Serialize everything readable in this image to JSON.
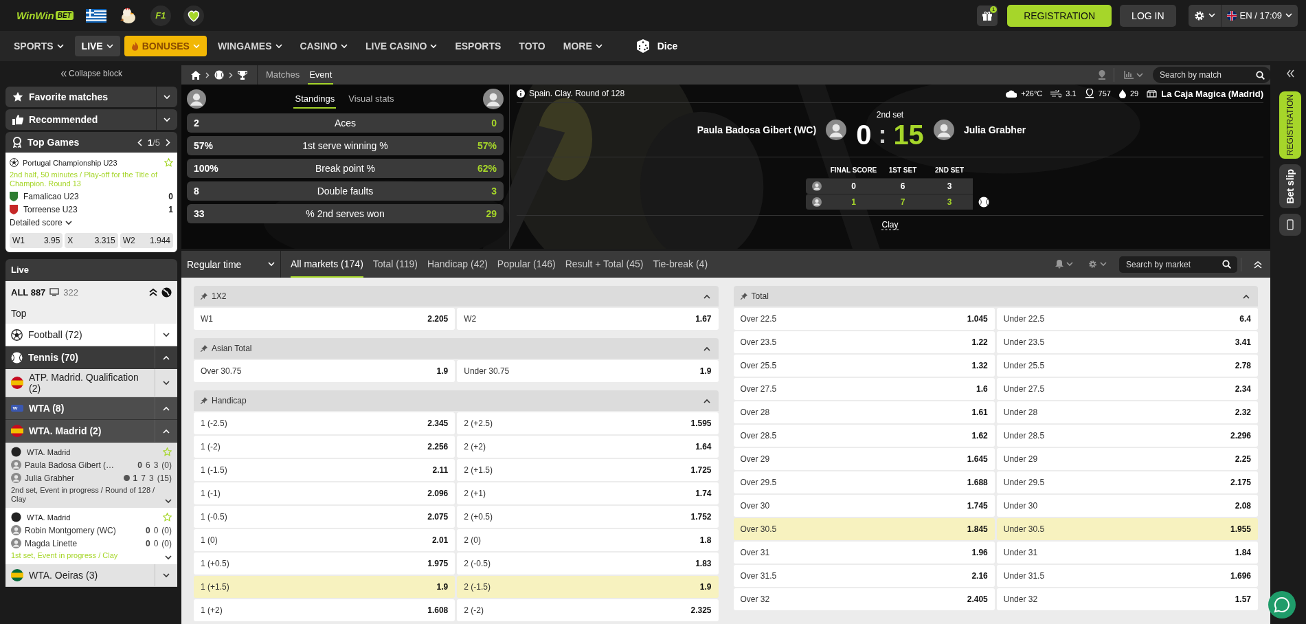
{
  "header": {
    "logo": "WinWin",
    "logo_badge": "BET",
    "f1_badge": "F1",
    "gift_count": "1",
    "registration": "REGISTRATION",
    "login": "LOG IN",
    "locale": "EN / 17:09"
  },
  "nav": [
    {
      "label": "SPORTS",
      "kind": "menu"
    },
    {
      "label": "LIVE",
      "kind": "active"
    },
    {
      "label": "BONUSES",
      "kind": "promo"
    },
    {
      "label": "WINGAMES",
      "kind": "menu"
    },
    {
      "label": "CASINO",
      "kind": "menu"
    },
    {
      "label": "LIVE CASINO",
      "kind": "menu"
    },
    {
      "label": "ESPORTS",
      "kind": "link"
    },
    {
      "label": "TOTO",
      "kind": "link"
    },
    {
      "label": "MORE",
      "kind": "menu"
    },
    {
      "label": "Dice",
      "kind": "dice"
    }
  ],
  "sidebar": {
    "collapse": "Collapse block",
    "panels": [
      {
        "label": "Favorite matches",
        "kind": "favorite"
      },
      {
        "label": "Recommended",
        "kind": "recommended"
      }
    ],
    "top_games": {
      "title": "Top Games",
      "page": "1",
      "pages": "/5",
      "game": {
        "league": "Portugal Championship U23",
        "status": "2nd half, 50 minutes / Play-off for the Title of Champion. Round 13",
        "teams": [
          {
            "name": "Famalicao U23",
            "score": "0",
            "color": "#2e7d32"
          },
          {
            "name": "Torreense U23",
            "score": "1",
            "color": "#c62828"
          }
        ],
        "details": "Detailed score",
        "odds": [
          {
            "label": "W1",
            "value": "3.95"
          },
          {
            "label": "X",
            "value": "3.315"
          },
          {
            "label": "W2",
            "value": "1.944"
          }
        ]
      }
    },
    "live": {
      "title": "Live",
      "all": "ALL 887",
      "tv_count": "322",
      "top": "Top",
      "items": [
        {
          "kind": "sport",
          "label": "Football (72)",
          "expanded": false
        },
        {
          "kind": "sport",
          "label": "Tennis (70)",
          "expanded": true
        },
        {
          "kind": "league",
          "label": "ATP. Madrid. Qualification (2)",
          "color": "#c60b1e",
          "expanded": false
        },
        {
          "kind": "tour",
          "label": "WTA (8)",
          "expanded": true
        },
        {
          "kind": "league",
          "label": "WTA. Madrid (2)",
          "color": "#c60b1e",
          "expanded": true
        },
        {
          "kind": "match",
          "league": "WTA. Madrid",
          "selected": true,
          "status": "2nd set, Event in progress / Round of 128 / Clay",
          "players": [
            {
              "name": "Paula Badosa Gibert (…",
              "serving": false,
              "scores": [
                "0",
                "6",
                "3"
              ],
              "points": "(0)"
            },
            {
              "name": "Julia Grabher",
              "serving": true,
              "scores": [
                "1",
                "7",
                "3"
              ],
              "points": "(15)"
            }
          ]
        },
        {
          "kind": "match",
          "league": "WTA. Madrid",
          "selected": false,
          "status": "1st set, Event in progress / Clay",
          "players": [
            {
              "name": "Robin Montgomery (WC)",
              "serving": false,
              "scores": [
                "0",
                "0"
              ],
              "points": "(0)"
            },
            {
              "name": "Magda Linette",
              "serving": false,
              "scores": [
                "0",
                "0"
              ],
              "points": "(0)"
            }
          ]
        },
        {
          "kind": "league",
          "label": "WTA. Oeiras (3)",
          "color": "#046a38",
          "expanded": false
        }
      ]
    }
  },
  "event": {
    "tabs": [
      {
        "label": "Matches",
        "selected": false
      },
      {
        "label": "Event",
        "selected": true
      }
    ],
    "search": {
      "placeholder": "Search by match"
    },
    "stats": {
      "tabs": [
        {
          "label": "Standings",
          "selected": true
        },
        {
          "label": "Visual stats",
          "selected": false
        }
      ],
      "rows": [
        {
          "home": "2",
          "label": "Aces",
          "away": "0"
        },
        {
          "home": "57%",
          "label": "1st serve winning %",
          "away": "57%"
        },
        {
          "home": "100%",
          "label": "Break point %",
          "away": "62%"
        },
        {
          "home": "8",
          "label": "Double faults",
          "away": "3"
        },
        {
          "home": "33",
          "label": "% 2nd serves won",
          "away": "29"
        }
      ]
    },
    "info": "Spain. Clay. Round of 128",
    "weather": {
      "temperature": "+26°C",
      "wind": "3.1",
      "pressure": "757",
      "humidity": "29",
      "venue": "La Caja Magica (Madrid)"
    },
    "period": "2nd set",
    "home": "Paula Badosa Gibert (WC)",
    "away": "Julia Grabher",
    "home_score": "0",
    "separator": ":",
    "away_score": "15",
    "table": {
      "columns": [
        "FINAL SCORE",
        "1ST SET",
        "2ND SET"
      ],
      "rows": [
        {
          "cells": [
            "0",
            "6",
            "3"
          ],
          "serving": false
        },
        {
          "cells": [
            "1",
            "7",
            "3"
          ],
          "serving": true
        }
      ]
    },
    "surface": "Clay"
  },
  "market_bar": {
    "period": "Regular time",
    "tabs": [
      {
        "label": "All markets (174)",
        "selected": true
      },
      {
        "label": "Total (119)",
        "selected": false
      },
      {
        "label": "Handicap (42)",
        "selected": false
      },
      {
        "label": "Popular (146)",
        "selected": false
      },
      {
        "label": "Result + Total (45)",
        "selected": false
      },
      {
        "label": "Tie-break (4)",
        "selected": false
      }
    ],
    "search": {
      "placeholder": "Search by market"
    }
  },
  "markets": [
    [
      {
        "title": "1X2",
        "rows": [
          {
            "highlighted": false,
            "cells": [
              {
                "label": "W1",
                "odds": "2.205"
              },
              {
                "label": "W2",
                "odds": "1.67"
              }
            ]
          }
        ]
      },
      {
        "title": "Asian Total",
        "rows": [
          {
            "highlighted": false,
            "cells": [
              {
                "label": "Over 30.75",
                "odds": "1.9"
              },
              {
                "label": "Under 30.75",
                "odds": "1.9"
              }
            ]
          }
        ]
      },
      {
        "title": "Handicap",
        "rows": [
          {
            "highlighted": false,
            "cells": [
              {
                "label": "1 (-2.5)",
                "odds": "2.345"
              },
              {
                "label": "2 (+2.5)",
                "odds": "1.595"
              }
            ]
          },
          {
            "highlighted": false,
            "cells": [
              {
                "label": "1 (-2)",
                "odds": "2.256"
              },
              {
                "label": "2 (+2)",
                "odds": "1.64"
              }
            ]
          },
          {
            "highlighted": false,
            "cells": [
              {
                "label": "1 (-1.5)",
                "odds": "2.11"
              },
              {
                "label": "2 (+1.5)",
                "odds": "1.725"
              }
            ]
          },
          {
            "highlighted": false,
            "cells": [
              {
                "label": "1 (-1)",
                "odds": "2.096"
              },
              {
                "label": "2 (+1)",
                "odds": "1.74"
              }
            ]
          },
          {
            "highlighted": false,
            "cells": [
              {
                "label": "1 (-0.5)",
                "odds": "2.075"
              },
              {
                "label": "2 (+0.5)",
                "odds": "1.752"
              }
            ]
          },
          {
            "highlighted": false,
            "cells": [
              {
                "label": "1 (0)",
                "odds": "2.01"
              },
              {
                "label": "2 (0)",
                "odds": "1.8"
              }
            ]
          },
          {
            "highlighted": false,
            "cells": [
              {
                "label": "1 (+0.5)",
                "odds": "1.975"
              },
              {
                "label": "2 (-0.5)",
                "odds": "1.83"
              }
            ]
          },
          {
            "highlighted": true,
            "cells": [
              {
                "label": "1 (+1.5)",
                "odds": "1.9"
              },
              {
                "label": "2 (-1.5)",
                "odds": "1.9"
              }
            ]
          },
          {
            "highlighted": false,
            "cells": [
              {
                "label": "1 (+2)",
                "odds": "1.608"
              },
              {
                "label": "2 (-2)",
                "odds": "2.325"
              }
            ]
          }
        ]
      }
    ],
    [
      {
        "title": "Total",
        "rows": [
          {
            "highlighted": false,
            "cells": [
              {
                "label": "Over 22.5",
                "odds": "1.045"
              },
              {
                "label": "Under 22.5",
                "odds": "6.4"
              }
            ]
          },
          {
            "highlighted": false,
            "cells": [
              {
                "label": "Over 23.5",
                "odds": "1.22"
              },
              {
                "label": "Under 23.5",
                "odds": "3.41"
              }
            ]
          },
          {
            "highlighted": false,
            "cells": [
              {
                "label": "Over 25.5",
                "odds": "1.32"
              },
              {
                "label": "Under 25.5",
                "odds": "2.78"
              }
            ]
          },
          {
            "highlighted": false,
            "cells": [
              {
                "label": "Over 27.5",
                "odds": "1.6"
              },
              {
                "label": "Under 27.5",
                "odds": "2.34"
              }
            ]
          },
          {
            "highlighted": false,
            "cells": [
              {
                "label": "Over 28",
                "odds": "1.61"
              },
              {
                "label": "Under 28",
                "odds": "2.32"
              }
            ]
          },
          {
            "highlighted": false,
            "cells": [
              {
                "label": "Over 28.5",
                "odds": "1.62"
              },
              {
                "label": "Under 28.5",
                "odds": "2.296"
              }
            ]
          },
          {
            "highlighted": false,
            "cells": [
              {
                "label": "Over 29",
                "odds": "1.645"
              },
              {
                "label": "Under 29",
                "odds": "2.25"
              }
            ]
          },
          {
            "highlighted": false,
            "cells": [
              {
                "label": "Over 29.5",
                "odds": "1.688"
              },
              {
                "label": "Under 29.5",
                "odds": "2.175"
              }
            ]
          },
          {
            "highlighted": false,
            "cells": [
              {
                "label": "Over 30",
                "odds": "1.745"
              },
              {
                "label": "Under 30",
                "odds": "2.08"
              }
            ]
          },
          {
            "highlighted": true,
            "cells": [
              {
                "label": "Over 30.5",
                "odds": "1.845"
              },
              {
                "label": "Under 30.5",
                "odds": "1.955"
              }
            ]
          },
          {
            "highlighted": false,
            "cells": [
              {
                "label": "Over 31",
                "odds": "1.96"
              },
              {
                "label": "Under 31",
                "odds": "1.84"
              }
            ]
          },
          {
            "highlighted": false,
            "cells": [
              {
                "label": "Over 31.5",
                "odds": "2.16"
              },
              {
                "label": "Under 31.5",
                "odds": "1.696"
              }
            ]
          },
          {
            "highlighted": false,
            "cells": [
              {
                "label": "Over 32",
                "odds": "2.405"
              },
              {
                "label": "Under 32",
                "odds": "1.57"
              }
            ]
          }
        ]
      }
    ]
  ],
  "rail": {
    "registration": "REGISTRATION",
    "bet_slip": "Bet slip"
  }
}
